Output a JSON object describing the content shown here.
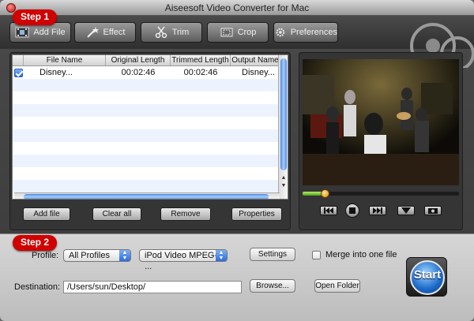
{
  "window": {
    "title": "Aiseesoft Video Converter for Mac"
  },
  "toolbar": {
    "add_file": "Add File",
    "effect": "Effect",
    "trim": "Trim",
    "crop": "Crop",
    "preferences": "Preferences"
  },
  "steps": {
    "step1": "Step 1",
    "step2": "Step 2"
  },
  "file_list": {
    "columns": [
      "File Name",
      "Original Length",
      "Trimmed Length",
      "Output Name"
    ],
    "rows": [
      {
        "checked": true,
        "file_name": "Disney...",
        "original_length": "00:02:46",
        "trimmed_length": "00:02:46",
        "output_name": "Disney..."
      }
    ]
  },
  "list_buttons": {
    "add_file": "Add file",
    "clear_all": "Clear all",
    "remove": "Remove",
    "properties": "Properties"
  },
  "preview": {
    "progress": 0.14
  },
  "output": {
    "profile_label": "Profile:",
    "profile_category": "All Profiles",
    "profile_format": "iPod Video MPEG-4 ...",
    "settings": "Settings",
    "merge_label": "Merge into one file",
    "merge_checked": false,
    "destination_label": "Destination:",
    "destination_value": "/Users/sun/Desktop/",
    "browse": "Browse...",
    "open_folder": "Open Folder",
    "start": "Start"
  }
}
